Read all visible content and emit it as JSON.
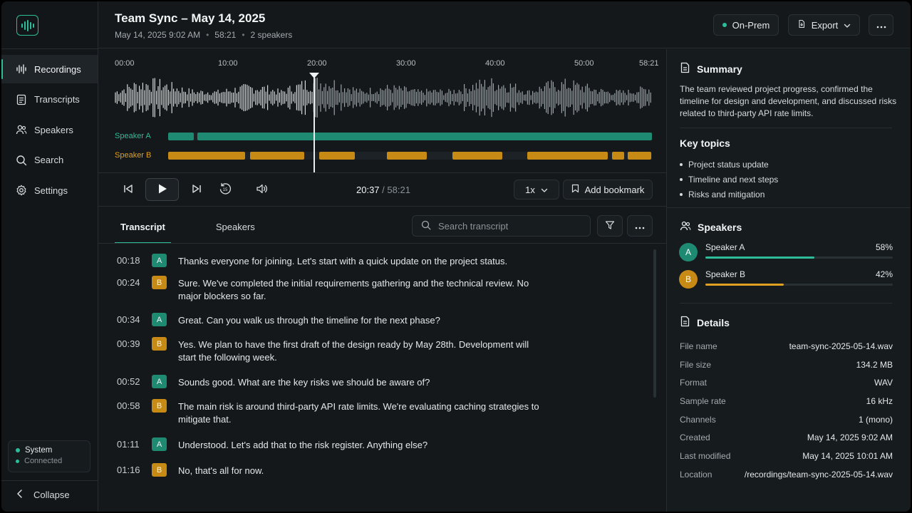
{
  "app": {
    "accent": "#2ebd9a",
    "speaker_a_color": "#1f8a72",
    "speaker_b_color": "#c78a15"
  },
  "sidebar": {
    "logo_icon": "waveform-logo-icon",
    "items": [
      {
        "label": "Recordings",
        "icon": "waveform-icon",
        "active": true
      },
      {
        "label": "Transcripts",
        "icon": "document-icon",
        "active": false
      },
      {
        "label": "Speakers",
        "icon": "users-icon",
        "active": false
      },
      {
        "label": "Search",
        "icon": "search-icon",
        "active": false
      },
      {
        "label": "Settings",
        "icon": "gear-icon",
        "active": false
      }
    ],
    "status": {
      "title": "System",
      "sub": "Connected"
    },
    "collapse_label": "Collapse"
  },
  "header": {
    "title": "Team Sync – May 14, 2025",
    "date": "May 14, 2025  9:02 AM",
    "duration": "58:21",
    "speakers": "2 speakers",
    "deploy_label": "On-Prem",
    "export_label": "Export"
  },
  "player": {
    "ticks": [
      "00:00",
      "10:00",
      "20:00",
      "30:00",
      "40:00",
      "50:00",
      "58:21"
    ],
    "duration_seconds": 3501,
    "position_seconds": 1237,
    "speaker_a_label": "Speaker A",
    "speaker_b_label": "Speaker B",
    "current_time": "20:37",
    "total_time": "58:21",
    "speed": "1x",
    "bookmark_label": "Add bookmark"
  },
  "transcript": {
    "tabs": [
      "Transcript",
      "Speakers"
    ],
    "search_placeholder": "Search transcript",
    "lines": [
      {
        "time": "00:18",
        "speaker": "A",
        "text": "Thanks everyone for joining. Let's start with a quick update on the project status."
      },
      {
        "time": "00:24",
        "speaker": "B",
        "text": "Sure. We've completed the initial requirements gathering and the technical review. No major blockers so far."
      },
      {
        "time": "00:34",
        "speaker": "A",
        "text": "Great. Can you walk us through the timeline for the next phase?"
      },
      {
        "time": "00:39",
        "speaker": "B",
        "text": "Yes. We plan to have the first draft of the design ready by May 28th. Development will start the following week."
      },
      {
        "time": "00:52",
        "speaker": "A",
        "text": "Sounds good. What are the key risks we should be aware of?"
      },
      {
        "time": "00:58",
        "speaker": "B",
        "text": "The main risk is around third-party API rate limits. We're evaluating caching strategies to mitigate that."
      },
      {
        "time": "01:11",
        "speaker": "A",
        "text": "Understood. Let's add that to the risk register. Anything else?"
      },
      {
        "time": "01:16",
        "speaker": "B",
        "text": "No, that's all for now."
      }
    ]
  },
  "panel": {
    "summary_title": "Summary",
    "summary_text": "The team reviewed project progress, confirmed the timeline for design and development, and discussed risks related to third-party API rate limits.",
    "topics_title": "Key topics",
    "topics": [
      "Project status update",
      "Timeline and next steps",
      "Risks and mitigation"
    ],
    "speakers_title": "Speakers",
    "speakers": [
      {
        "initial": "A",
        "name": "Speaker A",
        "pct": "58%",
        "share": 0.58
      },
      {
        "initial": "B",
        "name": "Speaker B",
        "pct": "42%",
        "share": 0.42
      }
    ],
    "details_title": "Details",
    "details": [
      {
        "key": "File name",
        "value": "team-sync-2025-05-14.wav"
      },
      {
        "key": "File size",
        "value": "134.2 MB"
      },
      {
        "key": "Format",
        "value": "WAV"
      },
      {
        "key": "Sample rate",
        "value": "16 kHz"
      },
      {
        "key": "Channels",
        "value": "1 (mono)"
      },
      {
        "key": "Created",
        "value": "May 14, 2025 9:02 AM"
      },
      {
        "key": "Last modified",
        "value": "May 14, 2025 10:01 AM"
      },
      {
        "key": "Location",
        "value": "/recordings/team-sync-2025-05-14.wav"
      }
    ]
  }
}
